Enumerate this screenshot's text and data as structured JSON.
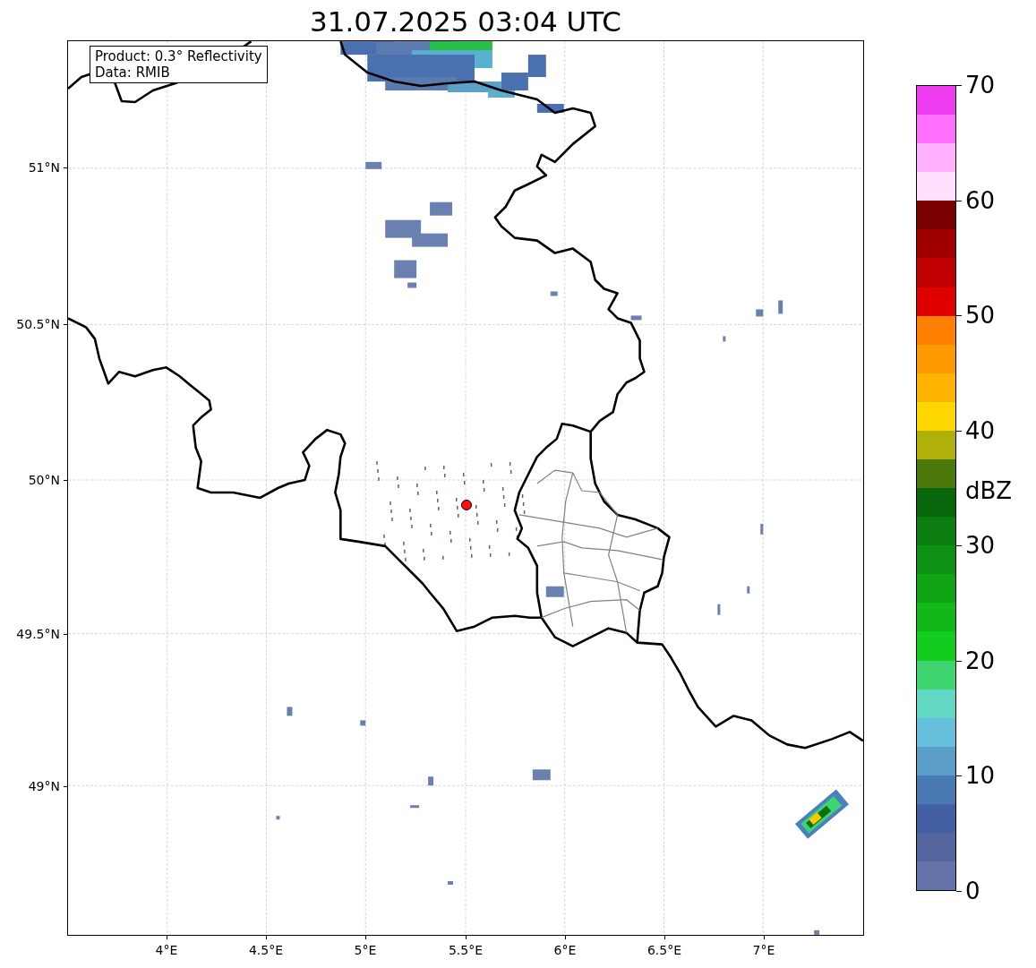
{
  "title": "31.07.2025 03:04 UTC",
  "map": {
    "info_box": [
      "Product: 0.3° Reflectivity",
      "Data: RMIB"
    ],
    "lat_labels": [
      "51°N",
      "50.5°N",
      "50°N",
      "49.5°N",
      "49°N"
    ],
    "lon_labels": [
      "4°E",
      "4.5°E",
      "5°E",
      "5.5°E",
      "6°E",
      "6.5°E",
      "7°E"
    ]
  },
  "colorbar": {
    "label": "dBZ",
    "ticks": [
      "70",
      "60",
      "50",
      "40",
      "30",
      "20",
      "10",
      "0"
    ],
    "segments": [
      {
        "color": "#f03cf0"
      },
      {
        "color": "#ff70ff"
      },
      {
        "color": "#ffb0ff"
      },
      {
        "color": "#ffe0ff"
      },
      {
        "color": "#7a0000"
      },
      {
        "color": "#a00000"
      },
      {
        "color": "#c00000"
      },
      {
        "color": "#e00000"
      },
      {
        "color": "#ff7f00"
      },
      {
        "color": "#ff9900"
      },
      {
        "color": "#ffb400"
      },
      {
        "color": "#ffd700"
      },
      {
        "color": "#b0b00a"
      },
      {
        "color": "#4a780a"
      },
      {
        "color": "#08660c"
      },
      {
        "color": "#0c7e12"
      },
      {
        "color": "#0e9014"
      },
      {
        "color": "#10a414"
      },
      {
        "color": "#12b818"
      },
      {
        "color": "#12cc1e"
      },
      {
        "color": "#3ed470"
      },
      {
        "color": "#62d8c4"
      },
      {
        "color": "#66c0dc"
      },
      {
        "color": "#5a9ec8"
      },
      {
        "color": "#4a7ab2"
      },
      {
        "color": "#4460a5"
      },
      {
        "color": "#55669e"
      },
      {
        "color": "#6673a8"
      }
    ]
  }
}
